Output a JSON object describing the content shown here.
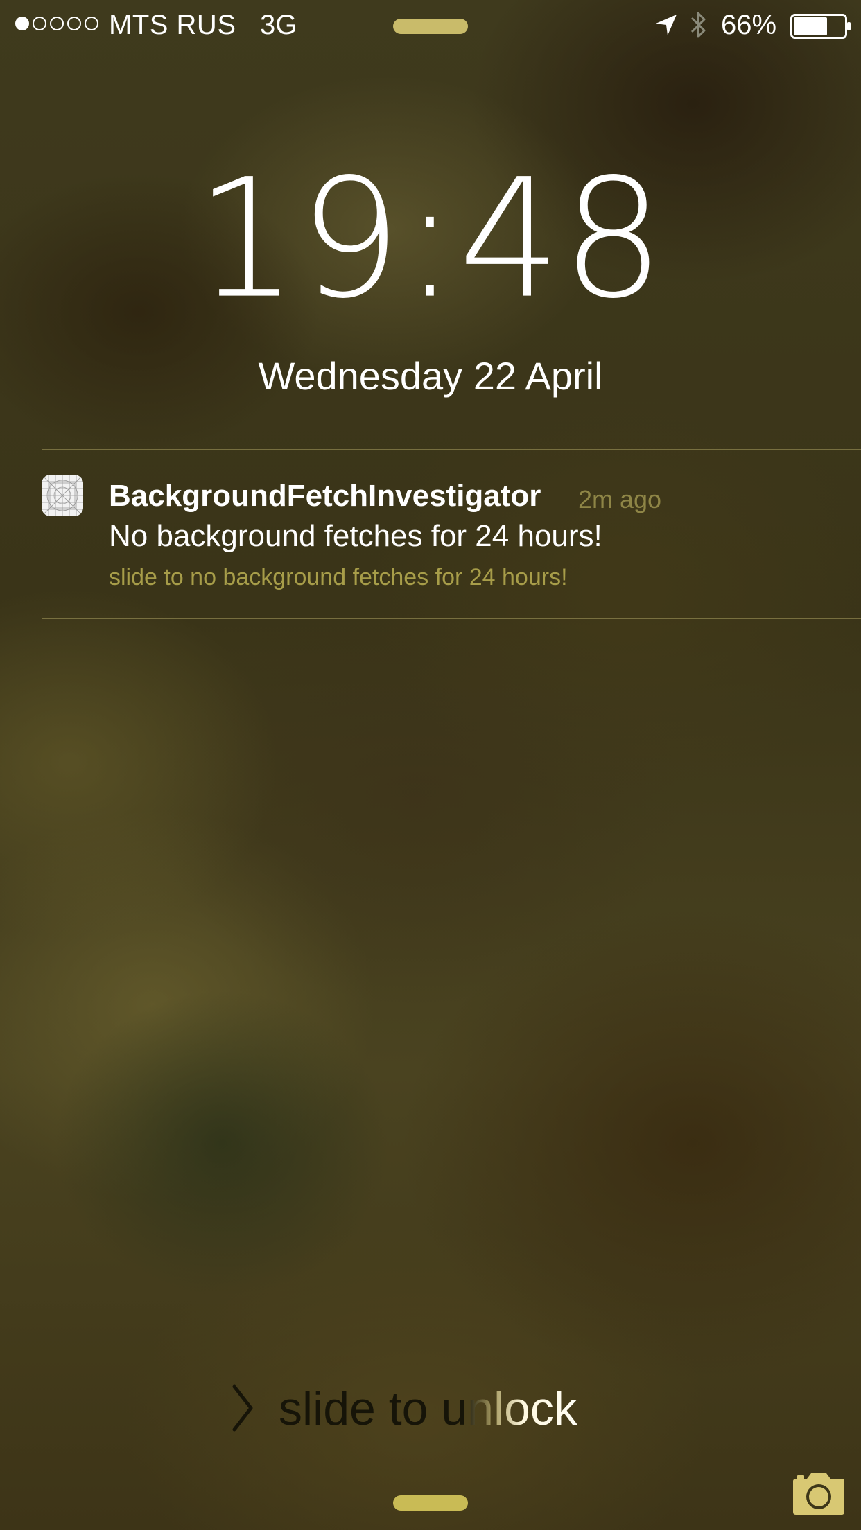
{
  "status_bar": {
    "signal_strength": 1,
    "signal_max": 5,
    "carrier": "MTS RUS",
    "network": "3G",
    "battery_percent": "66%",
    "battery_level": 0.66,
    "icons": [
      "location-arrow-icon",
      "bluetooth-icon",
      "battery-icon"
    ]
  },
  "lock_screen": {
    "time": "19:48",
    "date": "Wednesday 22 April"
  },
  "notification": {
    "app_icon": "app-placeholder-icon",
    "app_name": "BackgroundFetchInvestigator",
    "time_ago": "2m ago",
    "message": "No background fetches for 24 hours!",
    "slide_action": "slide to no background fetches for 24 hours!"
  },
  "unlock": {
    "label": "slide to unlock",
    "icon": "chevron-right-icon"
  },
  "camera": {
    "icon": "camera-icon"
  },
  "colors": {
    "accent_gold": "#c9bb6a",
    "time_ago_text": "#8e8546",
    "action_text": "#a79d49"
  }
}
